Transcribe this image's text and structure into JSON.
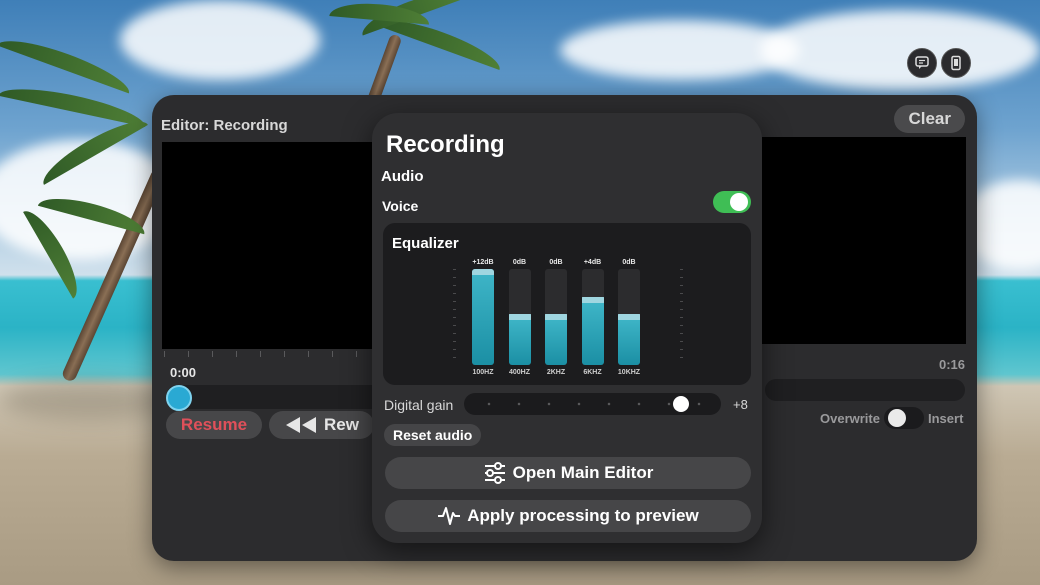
{
  "editor": {
    "title": "Editor: Recording",
    "clear_label": "Clear",
    "time_start": "0:00",
    "time_end": "0:16",
    "resume_label": "Resume",
    "rew_label": "Rew",
    "overwrite_label": "Overwrite",
    "insert_label": "Insert"
  },
  "panel": {
    "title": "Recording",
    "audio_label": "Audio",
    "voice_label": "Voice",
    "voice_enabled": true,
    "equalizer": {
      "title": "Equalizer",
      "bands": [
        {
          "freq": "100HZ",
          "value_label": "+12dB",
          "level": 1.0
        },
        {
          "freq": "400HZ",
          "value_label": "0dB",
          "level": 0.5
        },
        {
          "freq": "2KHZ",
          "value_label": "0dB",
          "level": 0.5
        },
        {
          "freq": "6KHZ",
          "value_label": "+4dB",
          "level": 0.68
        },
        {
          "freq": "10KHZ",
          "value_label": "0dB",
          "level": 0.5
        }
      ]
    },
    "digital_gain_label": "Digital gain",
    "digital_gain_value": "+8",
    "reset_label": "Reset audio",
    "open_main_editor_label": "Open Main Editor",
    "apply_label": "Apply processing to preview"
  },
  "colors": {
    "accent_toggle": "#3fbe55",
    "resume_text": "#e0505a",
    "eq_fill": "#3fb6c8",
    "scrub_knob": "#2aa9d3"
  },
  "icons": [
    "chat-bubble-icon",
    "phone-device-icon",
    "rewind-icon",
    "sliders-icon",
    "waveform-icon"
  ]
}
